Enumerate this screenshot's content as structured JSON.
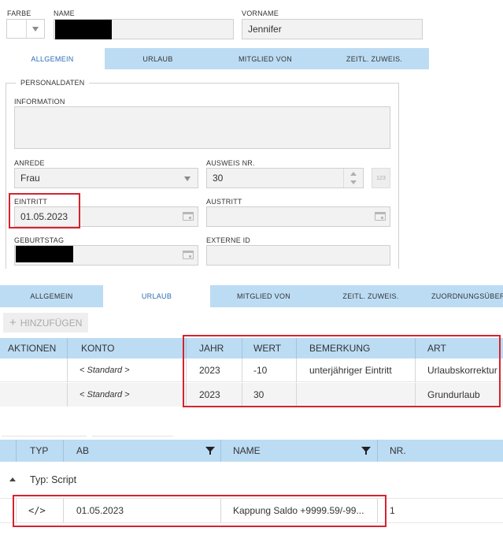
{
  "header": {
    "farbe_label": "FARBE",
    "name_label": "NAME",
    "vorname_label": "VORNAME",
    "vorname_value": "Jennifer"
  },
  "tabs_top": [
    "ALLGEMEIN",
    "URLAUB",
    "MITGLIED VON",
    "ZEITL. ZUWEIS."
  ],
  "personaldaten": {
    "legend": "PERSONALDATEN",
    "information_label": "INFORMATION",
    "information_value": "",
    "anrede_label": "ANREDE",
    "anrede_value": "Frau",
    "ausweis_label": "AUSWEIS NR.",
    "ausweis_value": "30",
    "ausweis_button": "123",
    "eintritt_label": "EINTRITT",
    "eintritt_value": "01.05.2023",
    "austritt_label": "AUSTRITT",
    "austritt_value": "",
    "geburtstag_label": "GEBURTSTAG",
    "externe_id_label": "EXTERNE ID",
    "externe_id_value": ""
  },
  "tabs_mid": [
    "ALLGEMEIN",
    "URLAUB",
    "MITGLIED VON",
    "ZEITL. ZUWEIS.",
    "ZUORDNUNGSÜBER"
  ],
  "urlaub": {
    "add_button": "HINZUFÜGEN",
    "add_icon": "plus-icon",
    "columns": [
      "AKTIONEN",
      "KONTO",
      "JAHR",
      "WERT",
      "BEMERKUNG",
      "ART"
    ],
    "rows": [
      {
        "konto": "< Standard >",
        "jahr": "2023",
        "wert": "-10",
        "bemerkung": "unterjähriger Eintritt",
        "art": "Urlaubskorrektur"
      },
      {
        "konto": "< Standard >",
        "jahr": "2023",
        "wert": "30",
        "bemerkung": "",
        "art": "Grundurlaub"
      }
    ]
  },
  "zuweisung": {
    "columns": [
      "TYP",
      "AB",
      "NAME",
      "NR."
    ],
    "group_label": "Typ: Script",
    "group_icon": "collapse-triangle-icon",
    "filter_icon": "filter-icon",
    "rows": [
      {
        "icon": "code-icon",
        "ab": "01.05.2023",
        "name": "Kappung Saldo +9999.59/-99...",
        "nr": "1"
      }
    ]
  },
  "colors": {
    "tab_bar": "#bcdcf4",
    "active_tab_text": "#2a6db5",
    "highlight_box": "#d6232e",
    "field_bg": "#f2f2f2"
  }
}
